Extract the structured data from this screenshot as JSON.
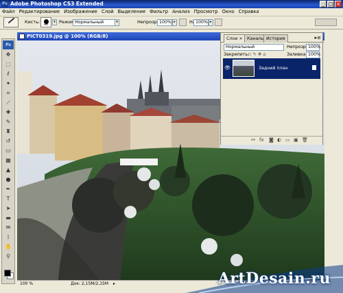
{
  "window": {
    "title": "Adobe Photoshop CS3 Extended",
    "app_icon": "Ps",
    "controls": {
      "minimize": "_",
      "maximize": "□",
      "close": "×"
    }
  },
  "menu": [
    "Файл",
    "Редактирование",
    "Изображение",
    "Слой",
    "Выделение",
    "Фильтр",
    "Анализ",
    "Просмотр",
    "Окно",
    "Справка"
  ],
  "options": {
    "brush_label": "Кисть:",
    "brush_size": "40",
    "mode_label": "Режим:",
    "mode_value": "Нормальный",
    "opacity_label": "Непрозр.:",
    "opacity_value": "100%",
    "flow_label": "Нажим:",
    "flow_value": "100%"
  },
  "toolbox": {
    "logo": "Ps",
    "tools": [
      {
        "name": "move-tool-icon",
        "glyph": "✥"
      },
      {
        "name": "marquee-tool-icon",
        "glyph": "⬚"
      },
      {
        "name": "lasso-tool-icon",
        "glyph": "ℓ"
      },
      {
        "name": "magic-wand-icon",
        "glyph": "✦"
      },
      {
        "name": "crop-tool-icon",
        "glyph": "⌗"
      },
      {
        "name": "slice-tool-icon",
        "glyph": "⟋"
      },
      {
        "name": "healing-brush-icon",
        "glyph": "✚"
      },
      {
        "name": "brush-tool-icon",
        "glyph": "✎"
      },
      {
        "name": "clone-stamp-icon",
        "glyph": "♜"
      },
      {
        "name": "history-brush-icon",
        "glyph": "↺"
      },
      {
        "name": "eraser-tool-icon",
        "glyph": "▭"
      },
      {
        "name": "gradient-tool-icon",
        "glyph": "▦"
      },
      {
        "name": "blur-tool-icon",
        "glyph": "▲"
      },
      {
        "name": "dodge-tool-icon",
        "glyph": "●"
      },
      {
        "name": "pen-tool-icon",
        "glyph": "✒"
      },
      {
        "name": "type-tool-icon",
        "glyph": "T"
      },
      {
        "name": "path-select-icon",
        "glyph": "➤"
      },
      {
        "name": "shape-tool-icon",
        "glyph": "▬"
      },
      {
        "name": "notes-tool-icon",
        "glyph": "✉"
      },
      {
        "name": "eyedropper-icon",
        "glyph": "⟟"
      },
      {
        "name": "hand-tool-icon",
        "glyph": "✋"
      },
      {
        "name": "zoom-tool-icon",
        "glyph": "⚲"
      }
    ],
    "foreground_color": "#000000",
    "background_color": "#ffffff"
  },
  "document": {
    "title": "PICT0319.jpg @ 100% (RGB/8)",
    "zoom": "100 %",
    "doc_info": "Док: 2,15M/2,15M"
  },
  "layers_panel": {
    "tabs": [
      "Слои ×",
      "Каналы",
      "История"
    ],
    "blend_mode": "Нормальный",
    "opacity_label": "Непрозр.:",
    "opacity_value": "100%",
    "lock_label": "Закрепить:",
    "fill_label": "Заливка:",
    "fill_value": "100%",
    "layer_name": "Задний план"
  },
  "watermark": "ArtDesain.ru",
  "colors": {
    "title_bar": "#0a246a",
    "doc_title": "#2a56c8",
    "selected_layer": "#0a246a",
    "chrome": "#ece9d8"
  }
}
